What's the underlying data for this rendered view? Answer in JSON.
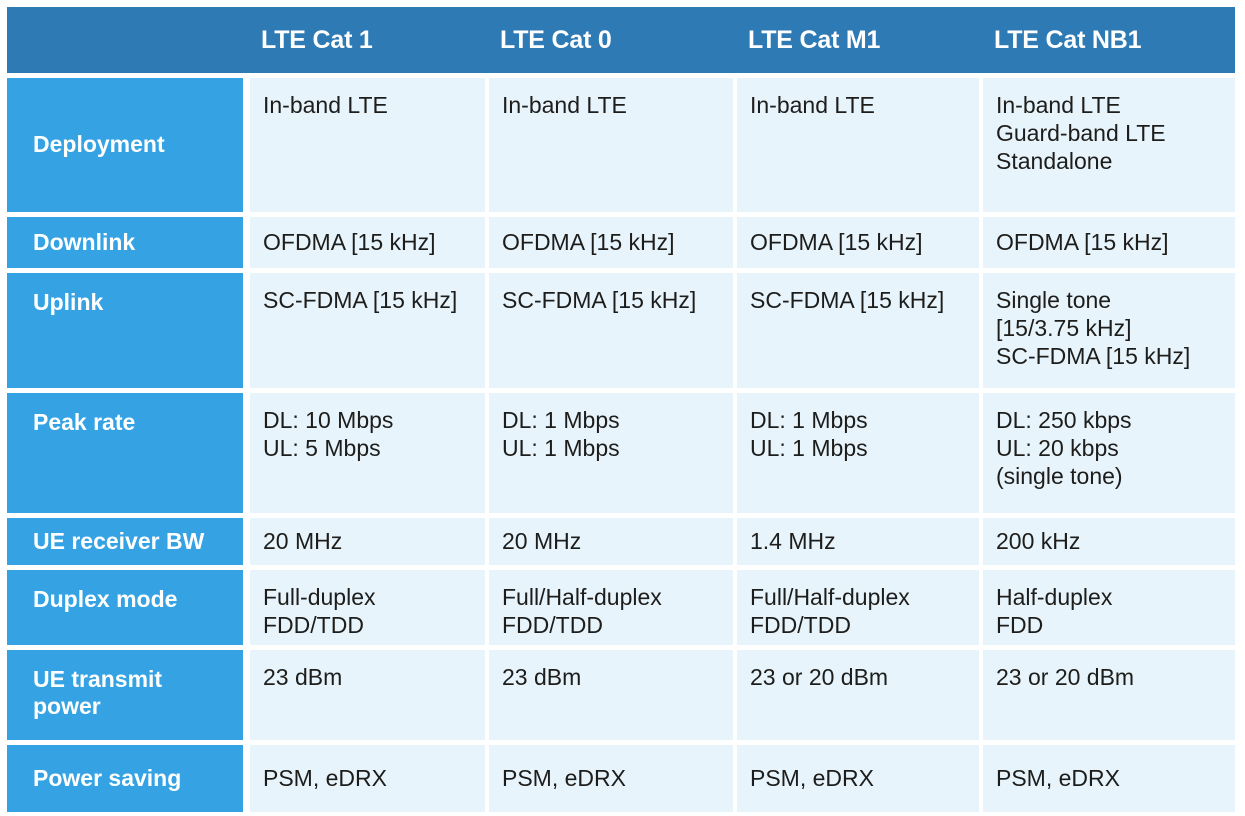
{
  "colors": {
    "header_bg": "#2E7AB4",
    "label_bg": "#35A3E3",
    "cell_bg": "#E8F4FB",
    "header_text": "#FFFFFF",
    "label_text": "#FFFFFF",
    "cell_text": "#1D1D1B",
    "page_bg": "#FFFFFF"
  },
  "table": {
    "corner_label": "",
    "columns": [
      "LTE Cat 1",
      "LTE Cat 0",
      "LTE Cat M1",
      "LTE Cat NB1"
    ],
    "rows": [
      {
        "label": "Deployment",
        "cells": [
          "In-band LTE",
          "In-band LTE",
          "In-band LTE",
          "In-band LTE\nGuard-band LTE\nStandalone"
        ]
      },
      {
        "label": "Downlink",
        "cells": [
          "OFDMA [15 kHz]",
          "OFDMA [15 kHz]",
          "OFDMA [15 kHz]",
          "OFDMA [15 kHz]"
        ]
      },
      {
        "label": "Uplink",
        "cells": [
          "SC-FDMA [15 kHz]",
          "SC-FDMA [15 kHz]",
          "SC-FDMA [15 kHz]",
          "Single tone\n[15/3.75 kHz]\nSC-FDMA [15 kHz]"
        ]
      },
      {
        "label": "Peak rate",
        "cells": [
          "DL: 10 Mbps\n UL:  5 Mbps",
          "DL: 1 Mbps\nUL: 1 Mbps",
          "DL: 1 Mbps\nUL: 1 Mbps",
          "DL: 250 kbps\n UL: 20 kbps\n(single tone)"
        ]
      },
      {
        "label": "UE receiver BW",
        "cells": [
          "20 MHz",
          "20 MHz",
          "1.4 MHz",
          "200 kHz"
        ]
      },
      {
        "label": "Duplex mode",
        "cells": [
          "Full-duplex\nFDD/TDD",
          "Full/Half-duplex\n FDD/TDD",
          "Full/Half-duplex\n FDD/TDD",
          "Half-duplex\n FDD"
        ]
      },
      {
        "label": "UE transmit\npower",
        "cells": [
          "23 dBm",
          " 23 dBm",
          " 23 or 20 dBm",
          "23 or 20 dBm"
        ]
      },
      {
        "label": "Power saving",
        "cells": [
          "PSM, eDRX",
          "PSM, eDRX",
          "PSM, eDRX",
          "PSM, eDRX"
        ]
      }
    ]
  }
}
